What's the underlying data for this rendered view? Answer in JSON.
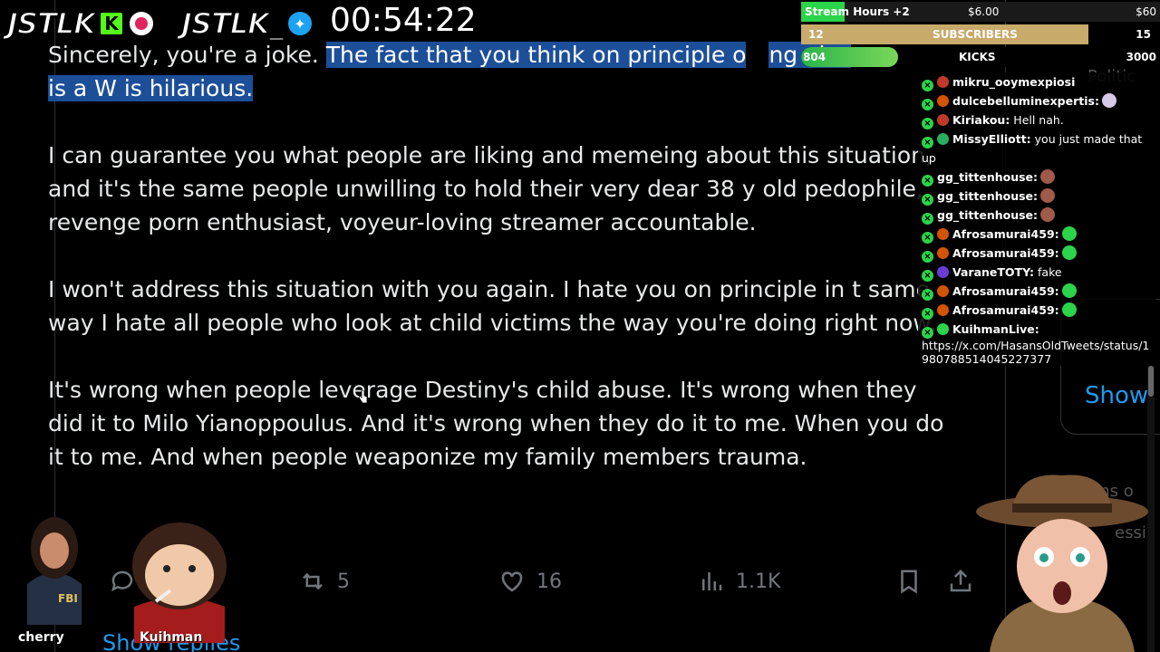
{
  "overlay": {
    "brand1": "JSTLK",
    "brand2": "JSTLK_",
    "kick_letter": "K",
    "timer": "00:54:22"
  },
  "goals": {
    "stream_hours": {
      "label": "Stream Hours +2",
      "mid": "$6.00",
      "end": "$60",
      "progress": 0.12
    },
    "subscribers": {
      "count": "12",
      "label": "SUBSCRIBERS",
      "target": "15",
      "progress": 0.8
    },
    "kicks": {
      "count": "804",
      "label": "KICKS",
      "target": "3000",
      "progress": 0.27
    }
  },
  "tweet": {
    "para1_plain": "Sincerely, you're a joke. ",
    "para1_highlight_a": "The fact that you think on principle o",
    "para1_hidden": "…",
    "para1_highlight_b": "ng else",
    "para1_highlight_c": "is a W is hilarious.",
    "para2": "I can guarantee you what people are liking and memeing about this situation, and it's the same people unwilling to hold their very dear 38 y old pedophile, revenge porn enthusiast, voyeur-loving streamer accountable.",
    "para3": "I won't address this situation with you again. I hate you on principle in t same way I hate all people who look at child victims the way you're doing right now.",
    "para4": "It's wrong when people leverage Destiny's child abuse. It's wrong when they did it to Milo Yianoppoulus. And it's wrong when they do it to me. When you do it to me. And when people weaponize my family members trauma.",
    "retweets": "5",
    "likes": "16",
    "views": "1.1K",
    "show_more": "Show replies"
  },
  "sidebar": {
    "show": "Show",
    "frag1": "Politic",
    "frag2": "rms o",
    "frag3": "essi"
  },
  "chat": [
    {
      "user": "mikru_ooymexpiosi",
      "text": "",
      "color": "#c0392b"
    },
    {
      "user": "dulcebelluminexpertis:",
      "text": "",
      "color": "#d35400",
      "emote": "#d7c9e8"
    },
    {
      "user": "Kiriakou:",
      "text": "Hell nah.",
      "color": "#c0392b"
    },
    {
      "user": "MissyElliott:",
      "text": "you just made that up",
      "color": "#27ae60"
    },
    {
      "user": "gg_tittenhouse:",
      "text": "",
      "color": "",
      "emote": "#a05a4a"
    },
    {
      "user": "gg_tittenhouse:",
      "text": "",
      "color": "",
      "emote": "#a05a4a"
    },
    {
      "user": "gg_tittenhouse:",
      "text": "",
      "color": "",
      "emote": "#a05a4a"
    },
    {
      "user": "Afrosamurai459:",
      "text": "",
      "color": "#d35400",
      "emote": "#2bd44a"
    },
    {
      "user": "Afrosamurai459:",
      "text": "",
      "color": "#d35400",
      "emote": "#2bd44a"
    },
    {
      "user": "VaraneTOTY:",
      "text": "fake",
      "color": "#6c3ad6"
    },
    {
      "user": "Afrosamurai459:",
      "text": "",
      "color": "#d35400",
      "emote": "#2bd44a"
    },
    {
      "user": "Afrosamurai459:",
      "text": "",
      "color": "#d35400",
      "emote": "#2bd44a"
    },
    {
      "user": "KuihmanLive:",
      "text": "https://x.com/HasansOldTweets/status/1980788514045227377",
      "color": "#2bd44a"
    }
  ],
  "avatars": {
    "cherry": "cherry",
    "kuihman": "Kuihman"
  },
  "colors": {
    "highlight": "#1d4f99",
    "link": "#1d9bf0",
    "muted": "#71767b"
  }
}
